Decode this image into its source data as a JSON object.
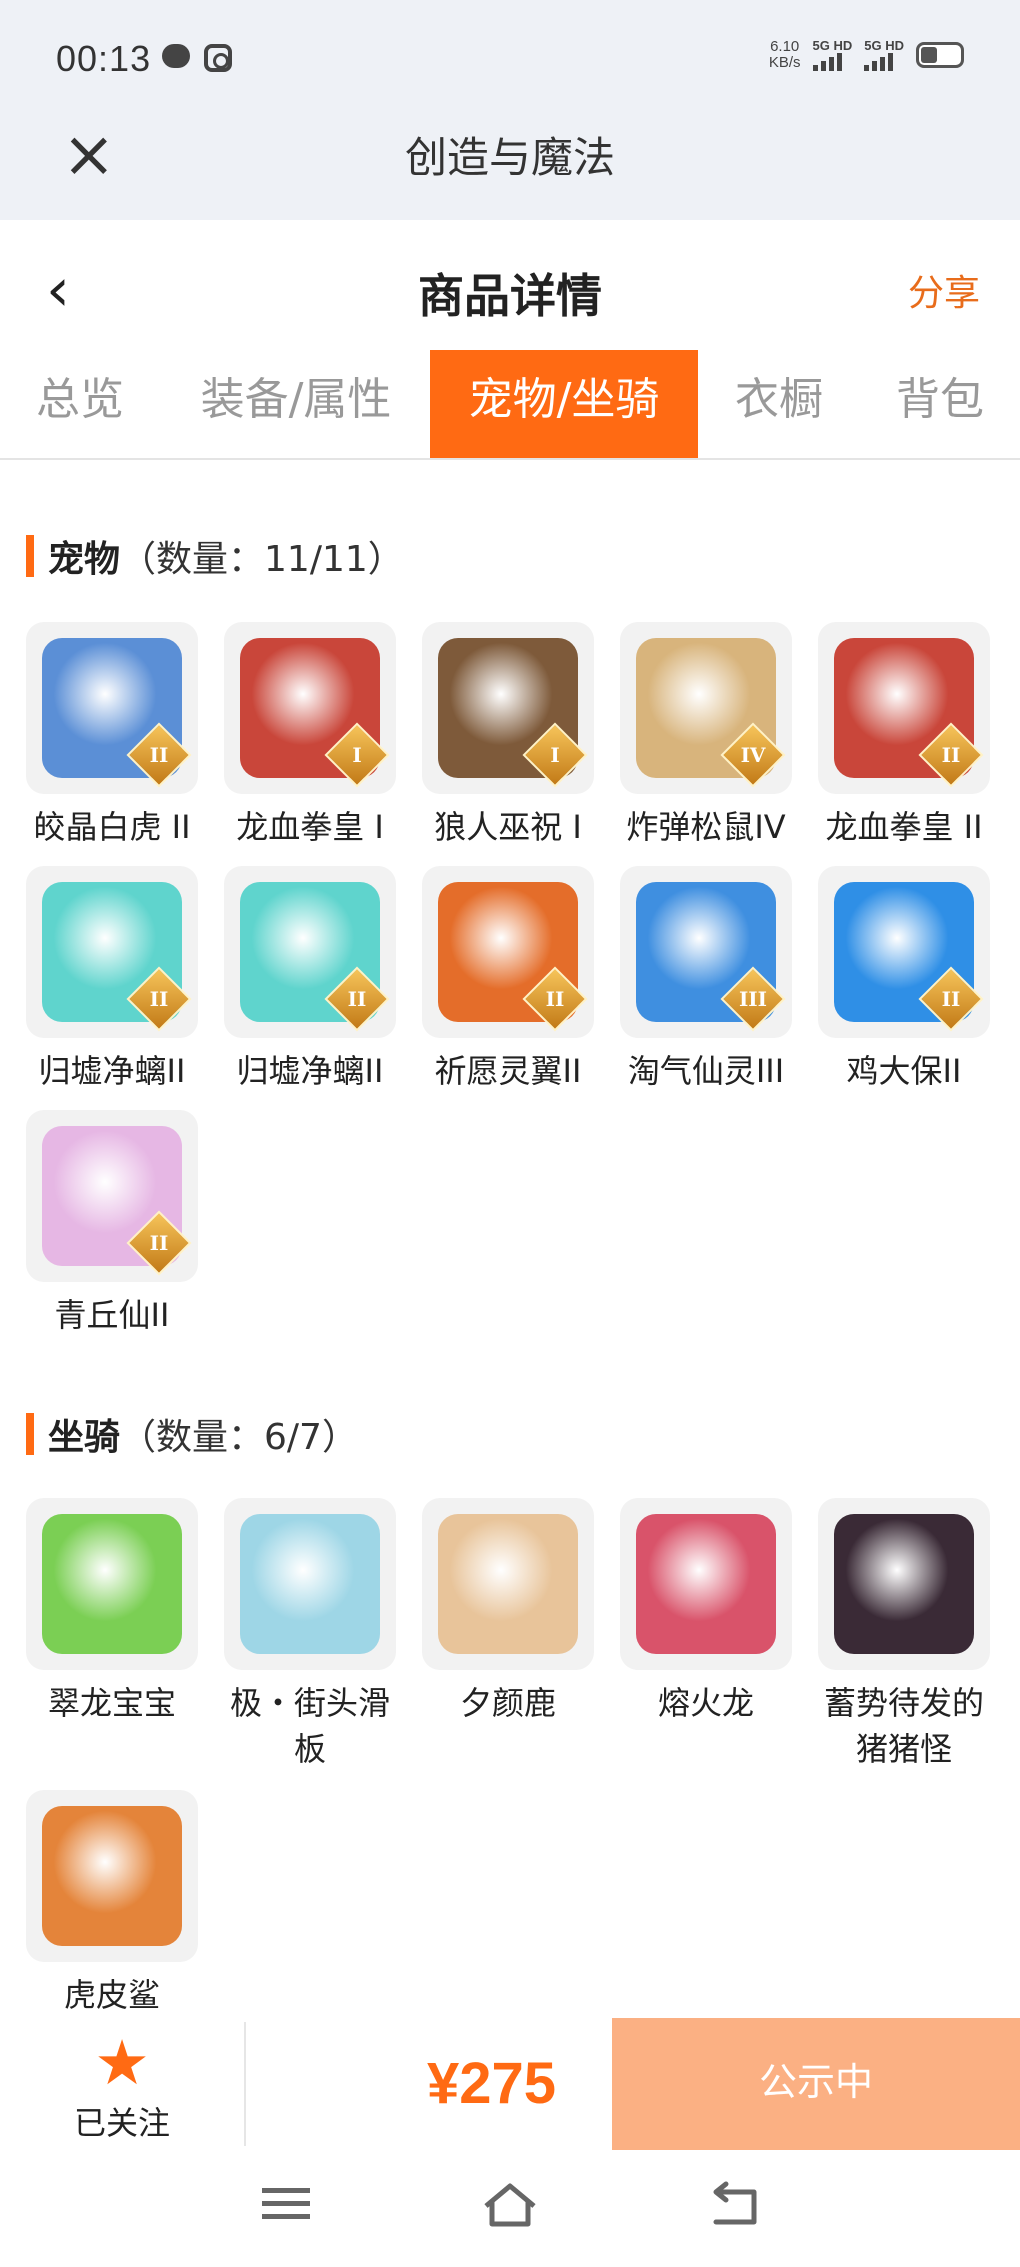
{
  "status_bar": {
    "time": "00:13",
    "speed_top": "6.10",
    "speed_bottom": "KB/s",
    "sim1": "5G HD",
    "sim2": "5G HD"
  },
  "app": {
    "title": "创造与魔法",
    "close_icon": "close-icon"
  },
  "header": {
    "title": "商品详情",
    "share_label": "分享",
    "back_icon": "back-arrow-icon"
  },
  "tabs": [
    {
      "label": "总览",
      "active": false
    },
    {
      "label": "装备/属性",
      "active": false
    },
    {
      "label": "宠物/坐骑",
      "active": true
    },
    {
      "label": "衣橱",
      "active": false
    },
    {
      "label": "背包",
      "active": false
    }
  ],
  "pets": {
    "title": "宠物",
    "count": "（数量：11/11）",
    "items": [
      {
        "name": "皎晶白虎 II",
        "badge": "II",
        "color": "#5b8fd6"
      },
      {
        "name": "龙血拳皇 I",
        "badge": "I",
        "color": "#c9463a"
      },
      {
        "name": "狼人巫祝 I",
        "badge": "I",
        "color": "#7e5a3a"
      },
      {
        "name": "炸弹松鼠IV",
        "badge": "IV",
        "color": "#d8b47c"
      },
      {
        "name": "龙血拳皇 II",
        "badge": "II",
        "color": "#c9463a"
      },
      {
        "name": "归墟净螭II",
        "badge": "II",
        "color": "#5fd4cd"
      },
      {
        "name": "归墟净螭II",
        "badge": "II",
        "color": "#5fd4cd"
      },
      {
        "name": "祈愿灵翼II",
        "badge": "II",
        "color": "#e46d2a"
      },
      {
        "name": "淘气仙灵III",
        "badge": "III",
        "color": "#3f8fe0"
      },
      {
        "name": "鸡大保II",
        "badge": "II",
        "color": "#2f8fe6"
      },
      {
        "name": "青丘仙II",
        "badge": "II",
        "color": "#e6b7e4"
      }
    ]
  },
  "mounts": {
    "title": "坐骑",
    "count": "（数量：6/7）",
    "items": [
      {
        "name": "翠龙宝宝",
        "color": "#7bcf54"
      },
      {
        "name": "极・街头滑板",
        "color": "#9ed6e6"
      },
      {
        "name": "夕颜鹿",
        "color": "#e8c49a"
      },
      {
        "name": "熔火龙",
        "color": "#d9536a"
      },
      {
        "name": "蓄势待发的猪猪怪",
        "color": "#3a2a36"
      },
      {
        "name": "虎皮鲨",
        "color": "#e4843a"
      }
    ]
  },
  "bottom": {
    "follow_label": "已关注",
    "star_icon": "star-icon",
    "price": "¥275",
    "status_button": "公示中"
  },
  "nav": {
    "menu_icon": "menu-icon",
    "home_icon": "home-icon",
    "back_icon": "return-icon"
  }
}
